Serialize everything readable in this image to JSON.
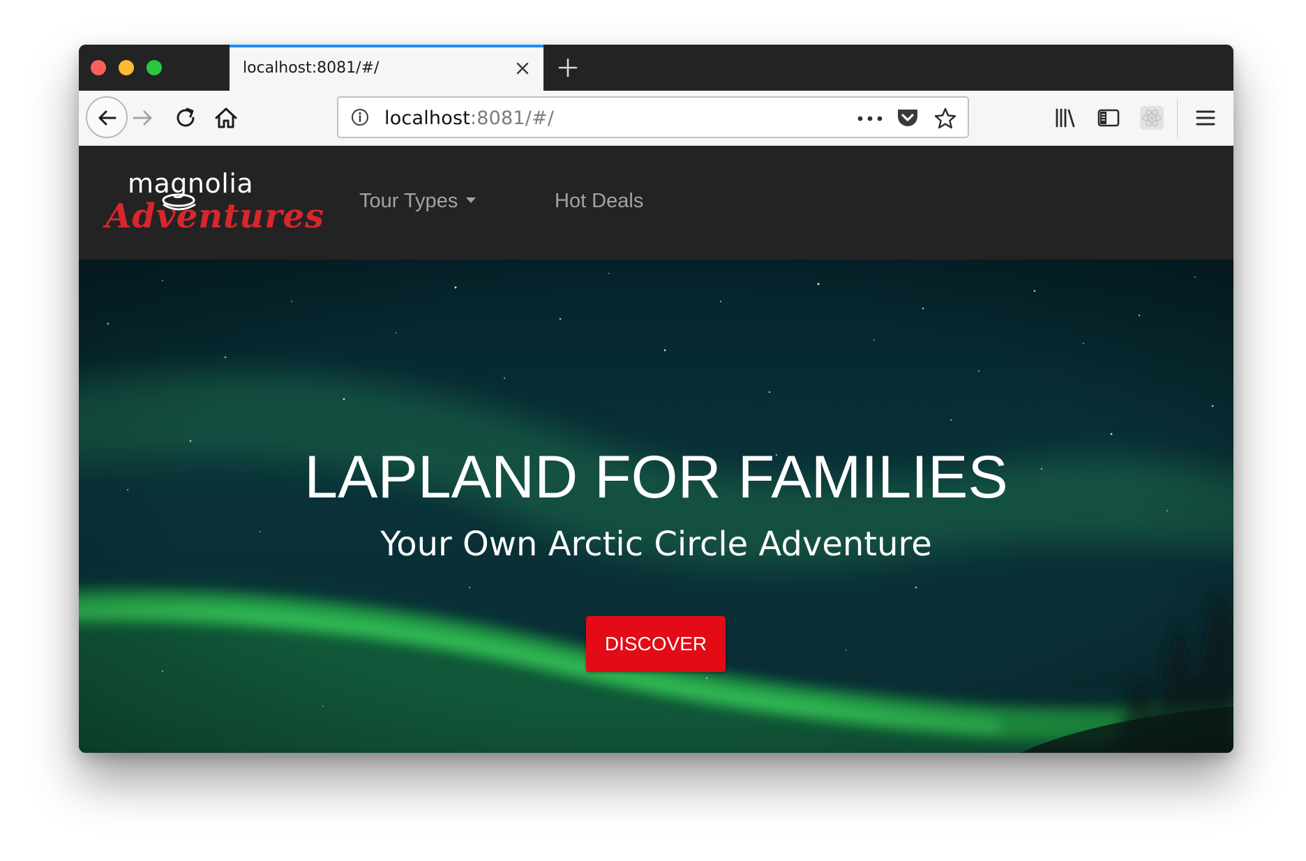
{
  "browser": {
    "tab": {
      "title": "localhost:8081/#/"
    },
    "url": {
      "host": "localhost",
      "rest": ":8081/#/"
    },
    "icons": {
      "back": "arrow-left-icon",
      "forward": "arrow-right-icon",
      "reload": "reload-icon",
      "home": "home-icon",
      "info": "info-icon",
      "page_actions": "more-dots-icon",
      "pocket": "pocket-icon",
      "bookmark": "star-icon",
      "library": "library-icon",
      "sidebar": "sidebar-icon",
      "extension": "react-icon",
      "menu": "hamburger-icon",
      "new_tab": "plus-icon",
      "close_tab": "close-icon"
    }
  },
  "site": {
    "logo": {
      "top": "magnolia",
      "bottom": "Adventures"
    },
    "nav": [
      {
        "label": "Tour Types",
        "has_dropdown": true
      },
      {
        "label": "Hot Deals",
        "has_dropdown": false
      }
    ],
    "hero": {
      "title": "LAPLAND FOR FAMILIES",
      "subtitle": "Your Own Arctic Circle Adventure",
      "button": "DISCOVER"
    }
  },
  "colors": {
    "tab_accent": "#1f8af7",
    "header_bg": "#232323",
    "logo_red": "#d8262f",
    "button_red": "#e20b16",
    "nav_text": "#a3a3a3"
  }
}
